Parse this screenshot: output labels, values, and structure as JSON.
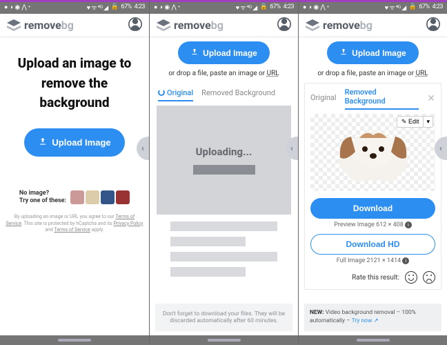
{
  "status": {
    "left_icons": "● ◑ ◉ ⋀ •",
    "right_icons": "♥ ᯤ ⁴ᴳ ◢",
    "battery": "67%",
    "time": "4:23"
  },
  "app": {
    "name_part1": "remove",
    "name_part2": "bg"
  },
  "screen1": {
    "hero_line1": "Upload an image to",
    "hero_line2": "remove the background",
    "upload_btn": "Upload Image",
    "noimage_line1": "No image?",
    "noimage_line2": "Try one of these:",
    "legal_prefix": "By uploading an image or URL you agree to our ",
    "legal_tos": "Terms of Service",
    "legal_mid": ". This site is protected by hCaptcha and its ",
    "legal_pp": "Privacy Policy",
    "legal_and": " and ",
    "legal_tos2": "Terms of Service",
    "legal_suffix": " apply."
  },
  "screen2": {
    "upload_btn": "Upload Image",
    "drop_hint_prefix": "or drop a file, paste an image or ",
    "drop_hint_url": "URL",
    "tab_original": "Original",
    "tab_removed": "Removed Background",
    "uploading": "Uploading...",
    "footer": "Don't forget to download your files. They will be discarded automatically after 60 minutes."
  },
  "screen3": {
    "upload_btn": "Upload Image",
    "drop_hint_prefix": "or drop a file, paste an image or ",
    "drop_hint_url": "URL",
    "tab_original": "Original",
    "tab_removed": "Removed Background",
    "edit_label": "Edit",
    "download": "Download",
    "preview_dims": "Preview Image 612 × 408",
    "download_hd": "Download HD",
    "full_dims": "Full Image 2121 × 1414",
    "rate_label": "Rate this result:",
    "promo_new": "NEW:",
    "promo_text": " Video background removal – 100% automatically – ",
    "promo_link": "Try now"
  }
}
